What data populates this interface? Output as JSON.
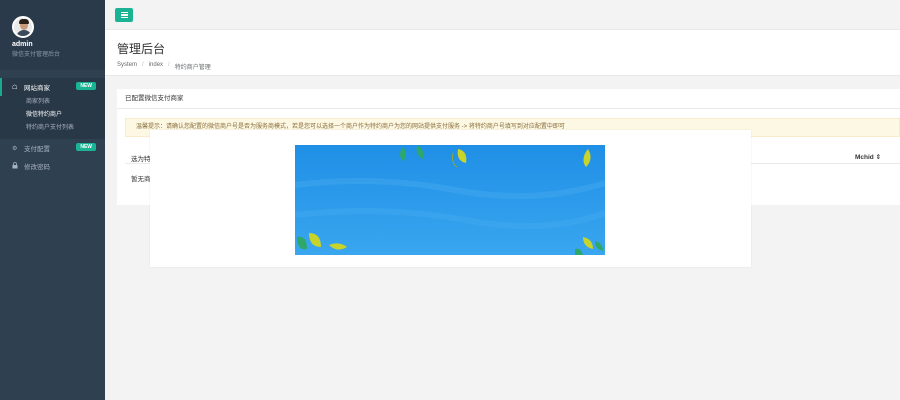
{
  "profile": {
    "name": "admin",
    "role": "微信支付管理后台"
  },
  "sidebar": {
    "items": [
      {
        "label": "网站商家",
        "badge": "NEW",
        "icon": "home-icon",
        "sub": [
          "商家列表",
          "微信特约商户",
          "特约商户支付列表"
        ]
      },
      {
        "label": "支付配置",
        "badge": "NEW",
        "icon": "gear-icon"
      },
      {
        "label": "修改密码",
        "icon": "lock-icon"
      }
    ]
  },
  "header": {
    "title": "管理后台",
    "breadcrumb": [
      "System",
      "index",
      "特约商户管理"
    ]
  },
  "panel": {
    "title": "已配置微信支付商家",
    "alert": "温馨提示：请确认您配置的微信商户号是否为服务商模式，若是您可以选择一个商户作为特约商户为您的网站提供支付服务 -> 将特约商户号填写到对应配置中即可",
    "columns": [
      "选为特",
      "Mchid ⇕"
    ],
    "empty_text": "暂无商"
  },
  "colors": {
    "accent": "#1ab394",
    "sidebar": "#2f4050",
    "sky": "#2196e8",
    "leaf_yellow": "#c8d42a",
    "leaf_green": "#2ea86a"
  }
}
